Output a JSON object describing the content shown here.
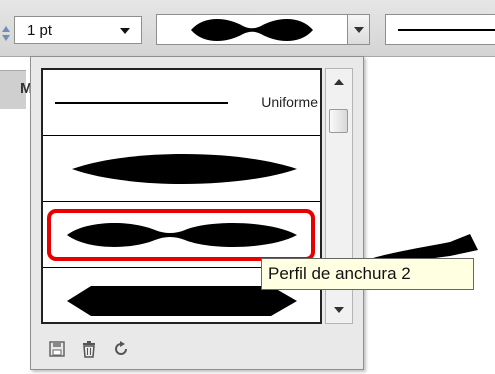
{
  "toolbar": {
    "stroke_weight": "1 pt",
    "stroke_weight_dropdown_icon": "chevron-down-icon",
    "profile_dropdown_icon": "chevron-down-icon"
  },
  "side_tab": {
    "label": "M"
  },
  "profile_list": {
    "items": [
      {
        "label": "Uniforme",
        "shape": "uniform"
      },
      {
        "label": "",
        "shape": "width-profile-1"
      },
      {
        "label": "",
        "shape": "width-profile-2",
        "selected": true
      },
      {
        "label": "",
        "shape": "width-profile-3"
      }
    ],
    "highlight_color": "#e80000"
  },
  "scrollbar": {
    "up_icon": "arrow-up-icon",
    "down_icon": "arrow-down-icon"
  },
  "footer_icons": [
    "save-icon",
    "delete-icon",
    "reset-icon"
  ],
  "tooltip": {
    "text": "Perfil de anchura 2"
  }
}
